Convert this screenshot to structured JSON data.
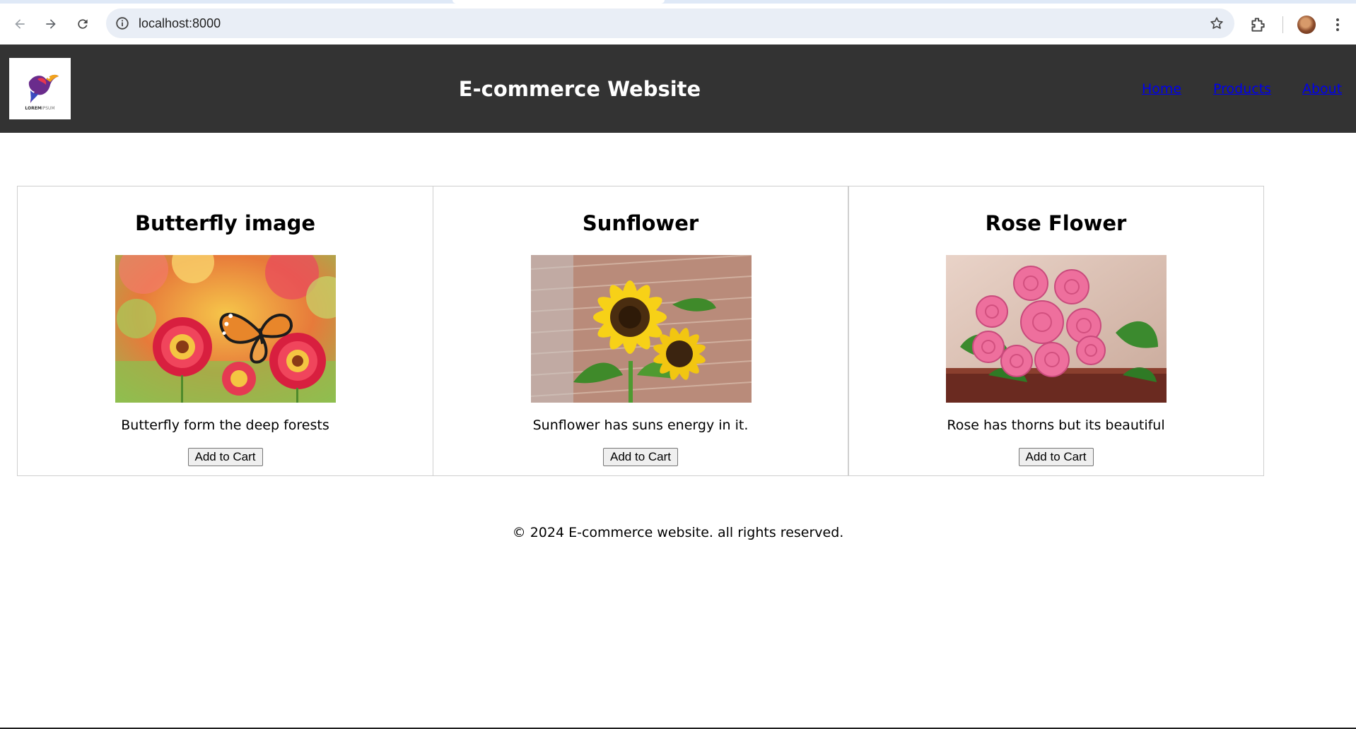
{
  "browser": {
    "url": "localhost:8000",
    "icons": [
      "back-arrow-icon",
      "forward-arrow-icon",
      "reload-icon",
      "site-info-icon",
      "bookmark-star-icon",
      "extensions-icon",
      "profile-avatar",
      "kebab-menu-icon"
    ]
  },
  "header": {
    "logo_text": "LOREM IPSUM",
    "title": "E-commerce Website",
    "nav": [
      {
        "label": "Home"
      },
      {
        "label": "Products"
      },
      {
        "label": "About"
      }
    ],
    "background": "#333333"
  },
  "products": [
    {
      "title": "Butterfly image",
      "description": "Butterfly form the deep forests",
      "button": "Add to Cart",
      "image": "butterfly-on-flowers"
    },
    {
      "title": "Sunflower",
      "description": "Sunflower has suns energy in it.",
      "button": "Add to Cart",
      "image": "sunflowers-brick-wall"
    },
    {
      "title": "Rose Flower",
      "description": "Rose has thorns but its beautiful",
      "button": "Add to Cart",
      "image": "pink-roses-bouquet"
    }
  ],
  "footer": {
    "text": "© 2024 E-commerce website. all rights reserved."
  }
}
